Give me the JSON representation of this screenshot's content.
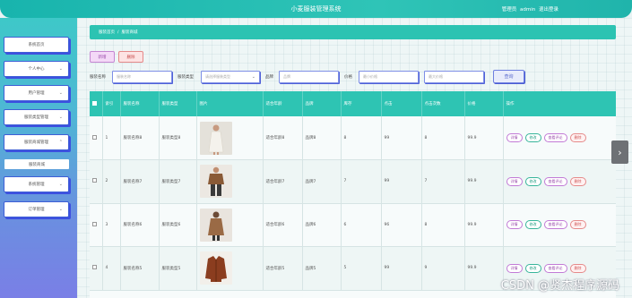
{
  "header": {
    "title": "小麦服装管理系统",
    "user_role": "管理员",
    "user_name": "admin",
    "logout": "退出登录"
  },
  "sidebar": {
    "items": [
      {
        "label": "系统首页",
        "has_chevron": false
      },
      {
        "label": "个人中心",
        "has_chevron": true
      },
      {
        "label": "用户管理",
        "has_chevron": true
      },
      {
        "label": "服装类型管理",
        "has_chevron": true
      },
      {
        "label": "服装商城管理",
        "has_chevron": true,
        "expanded": true
      },
      {
        "label": "系统管理",
        "has_chevron": true
      },
      {
        "label": "订单管理",
        "has_chevron": true
      }
    ],
    "subitem": "服装商城"
  },
  "breadcrumb": {
    "home": "服装首页",
    "separator": "/",
    "current": "服装商城"
  },
  "toolbar": {
    "add": "新增",
    "delete": "删除"
  },
  "search": {
    "name_label": "服装名称",
    "name_placeholder": "服装名称",
    "type_label": "服装类型",
    "type_placeholder": "请选择服装类型",
    "brand_label": "品牌",
    "brand_placeholder": "品牌",
    "price_label": "价格",
    "min_placeholder": "最小价格",
    "max_placeholder": "最大价格",
    "button": "查询"
  },
  "table": {
    "headers": [
      "",
      "索引",
      "服装名称",
      "服装类型",
      "图片",
      "适合年龄",
      "品牌",
      "库存",
      "点击",
      "点击次数",
      "价格",
      "操作"
    ],
    "rows": [
      {
        "index": "1",
        "name": "服装名称8",
        "type": "服装类型8",
        "age": "适合年龄8",
        "brand": "品牌8",
        "stock": "8",
        "clicks": "99",
        "click_count": "8",
        "price": "99.9",
        "image": "white-dress"
      },
      {
        "index": "2",
        "name": "服装名称7",
        "type": "服装类型7",
        "age": "适合年龄7",
        "brand": "品牌7",
        "stock": "7",
        "clicks": "99",
        "click_count": "7",
        "price": "99.9",
        "image": "brown-jacket-man"
      },
      {
        "index": "3",
        "name": "服装名称6",
        "type": "服装类型6",
        "age": "适合年龄6",
        "brand": "品牌6",
        "stock": "6",
        "clicks": "96",
        "click_count": "8",
        "price": "99.9",
        "image": "brown-coat-woman"
      },
      {
        "index": "4",
        "name": "服装名称5",
        "type": "服装类型5",
        "age": "适合年龄5",
        "brand": "品牌5",
        "stock": "5",
        "clicks": "99",
        "click_count": "9",
        "price": "99.9",
        "image": "leather-jacket"
      }
    ],
    "ops": {
      "detail": "详情",
      "edit": "修改",
      "review": "查看评论",
      "delete": "删除"
    }
  },
  "watermark": "CSDN @贤杰程序源码",
  "colors": {
    "accent": "#2ec4b3",
    "sidebar_top": "#3ec8c8",
    "sidebar_bottom": "#7a7fe6"
  }
}
